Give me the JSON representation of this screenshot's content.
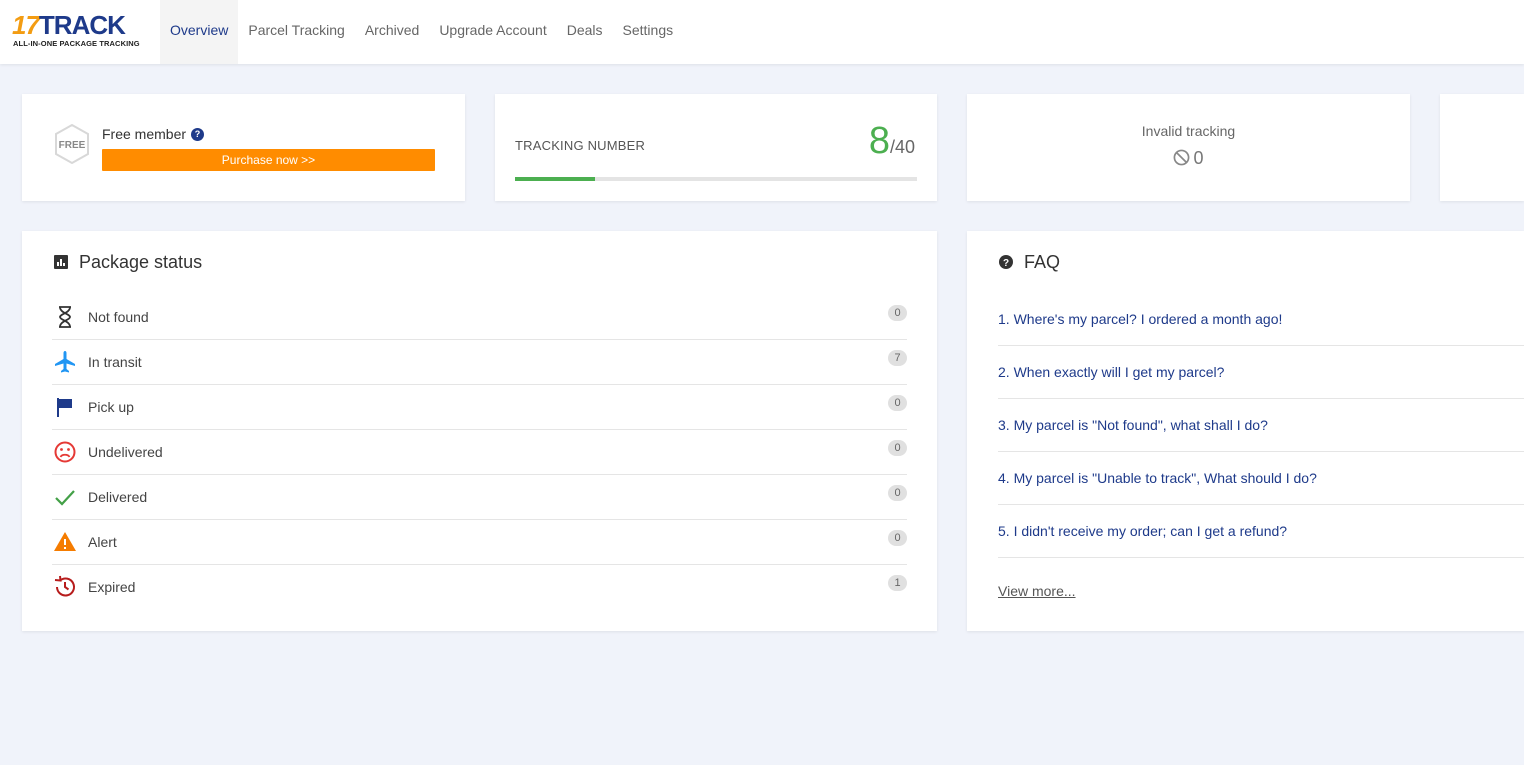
{
  "logo": {
    "brand_num": "17",
    "brand_text": "TRACK",
    "tagline": "ALL-IN-ONE PACKAGE TRACKING"
  },
  "nav": {
    "items": [
      {
        "label": "Overview",
        "active": true
      },
      {
        "label": "Parcel Tracking"
      },
      {
        "label": "Archived"
      },
      {
        "label": "Upgrade Account"
      },
      {
        "label": "Deals"
      },
      {
        "label": "Settings"
      }
    ]
  },
  "member": {
    "badge_text": "FREE",
    "title": "Free member",
    "help": "?",
    "purchase_label": "Purchase now >>"
  },
  "tracking": {
    "label": "TRACKING NUMBER",
    "used": 8,
    "used_text": "8",
    "limit_text": "/40",
    "limit": 40
  },
  "invalid": {
    "label": "Invalid tracking",
    "count": "0"
  },
  "package_status": {
    "title": "Package status",
    "items": [
      {
        "label": "Not found",
        "count": "0",
        "icon": "hourglass-icon"
      },
      {
        "label": "In transit",
        "count": "7",
        "icon": "airplane-icon"
      },
      {
        "label": "Pick up",
        "count": "0",
        "icon": "flag-icon"
      },
      {
        "label": "Undelivered",
        "count": "0",
        "icon": "sad-face-icon"
      },
      {
        "label": "Delivered",
        "count": "0",
        "icon": "checkmark-icon"
      },
      {
        "label": "Alert",
        "count": "0",
        "icon": "warning-icon"
      },
      {
        "label": "Expired",
        "count": "1",
        "icon": "history-icon"
      }
    ]
  },
  "faq": {
    "title": "FAQ",
    "items": [
      "1. Where's my parcel? I ordered a month ago!",
      "2. When exactly will I get my parcel?",
      "3. My parcel is \"Not found\", what shall I do?",
      "4. My parcel is \"Unable to track\", What should I do?",
      "5. I didn't receive my order; can I get a refund?"
    ],
    "view_more": "View more..."
  },
  "colors": {
    "brand_blue": "#1e3a8a",
    "brand_orange": "#f39c12",
    "purchase_orange": "#ff8c00",
    "progress_green": "#4caf50",
    "background": "#f0f3fa"
  }
}
